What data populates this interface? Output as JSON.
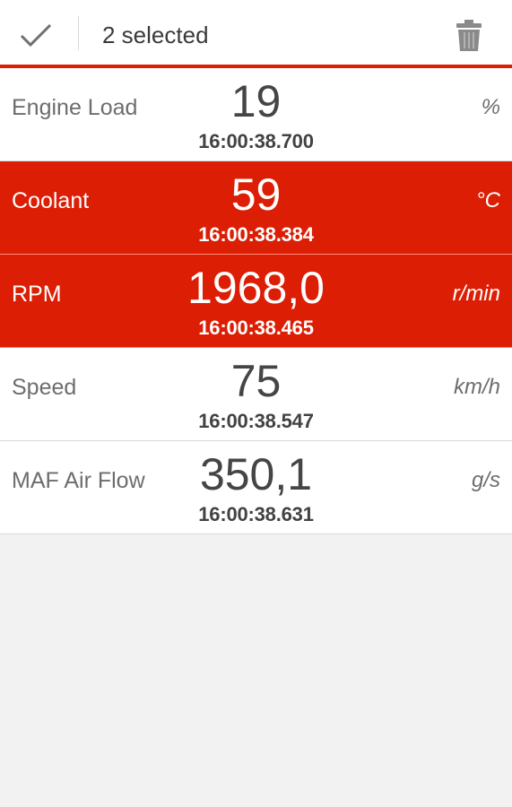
{
  "action_bar": {
    "title": "2 selected",
    "done_icon": "check-icon",
    "delete_icon": "trash-icon"
  },
  "colors": {
    "accent": "#dc1e04",
    "background": "#f2f2f2"
  },
  "rows": [
    {
      "name": "Engine Load",
      "value": "19",
      "time": "16:00:38.700",
      "unit": "%",
      "selected": false
    },
    {
      "name": "Coolant",
      "value": "59",
      "time": "16:00:38.384",
      "unit": "°C",
      "selected": true
    },
    {
      "name": "RPM",
      "value": "1968,0",
      "time": "16:00:38.465",
      "unit": "r/min",
      "selected": true
    },
    {
      "name": "Speed",
      "value": "75",
      "time": "16:00:38.547",
      "unit": "km/h",
      "selected": false
    },
    {
      "name": "MAF Air Flow",
      "value": "350,1",
      "time": "16:00:38.631",
      "unit": "g/s",
      "selected": false
    }
  ]
}
